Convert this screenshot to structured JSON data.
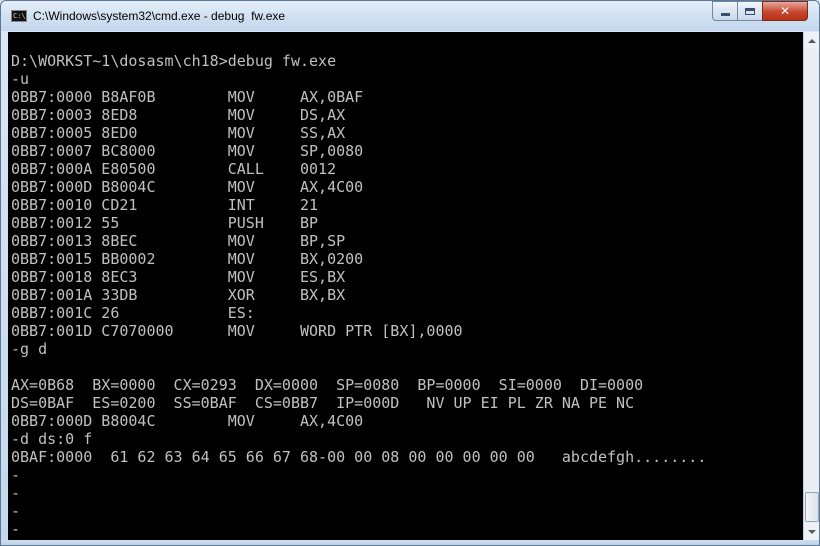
{
  "window": {
    "title": "C:\\Windows\\system32\\cmd.exe - debug  fw.exe",
    "app_icon_text": "C:\\",
    "ghost_title": "",
    "icons": {
      "app": "console-app-icon",
      "minimize": "minimize-icon",
      "maximize": "maximize-icon",
      "close": "close-icon"
    },
    "colors": {
      "console_bg": "#000000",
      "console_text": "#c0c0c0",
      "close": "#c7472e"
    }
  },
  "console": {
    "lines": [
      "D:\\WORKST~1\\dosasm\\ch18>debug fw.exe",
      "-u",
      "0BB7:0000 B8AF0B        MOV     AX,0BAF",
      "0BB7:0003 8ED8          MOV     DS,AX",
      "0BB7:0005 8ED0          MOV     SS,AX",
      "0BB7:0007 BC8000        MOV     SP,0080",
      "0BB7:000A E80500        CALL    0012",
      "0BB7:000D B8004C        MOV     AX,4C00",
      "0BB7:0010 CD21          INT     21",
      "0BB7:0012 55            PUSH    BP",
      "0BB7:0013 8BEC          MOV     BP,SP",
      "0BB7:0015 BB0002        MOV     BX,0200",
      "0BB7:0018 8EC3          MOV     ES,BX",
      "0BB7:001A 33DB          XOR     BX,BX",
      "0BB7:001C 26            ES:",
      "0BB7:001D C7070000      MOV     WORD PTR [BX],0000",
      "-g d",
      "",
      "AX=0B68  BX=0000  CX=0293  DX=0000  SP=0080  BP=0000  SI=0000  DI=0000",
      "DS=0BAF  ES=0200  SS=0BAF  CS=0BB7  IP=000D   NV UP EI PL ZR NA PE NC",
      "0BB7:000D B8004C        MOV     AX,4C00",
      "-d ds:0 f",
      "0BAF:0000  61 62 63 64 65 66 67 68-00 00 08 00 00 00 00 00   abcdefgh........",
      "-",
      "-",
      "-",
      "-"
    ]
  }
}
